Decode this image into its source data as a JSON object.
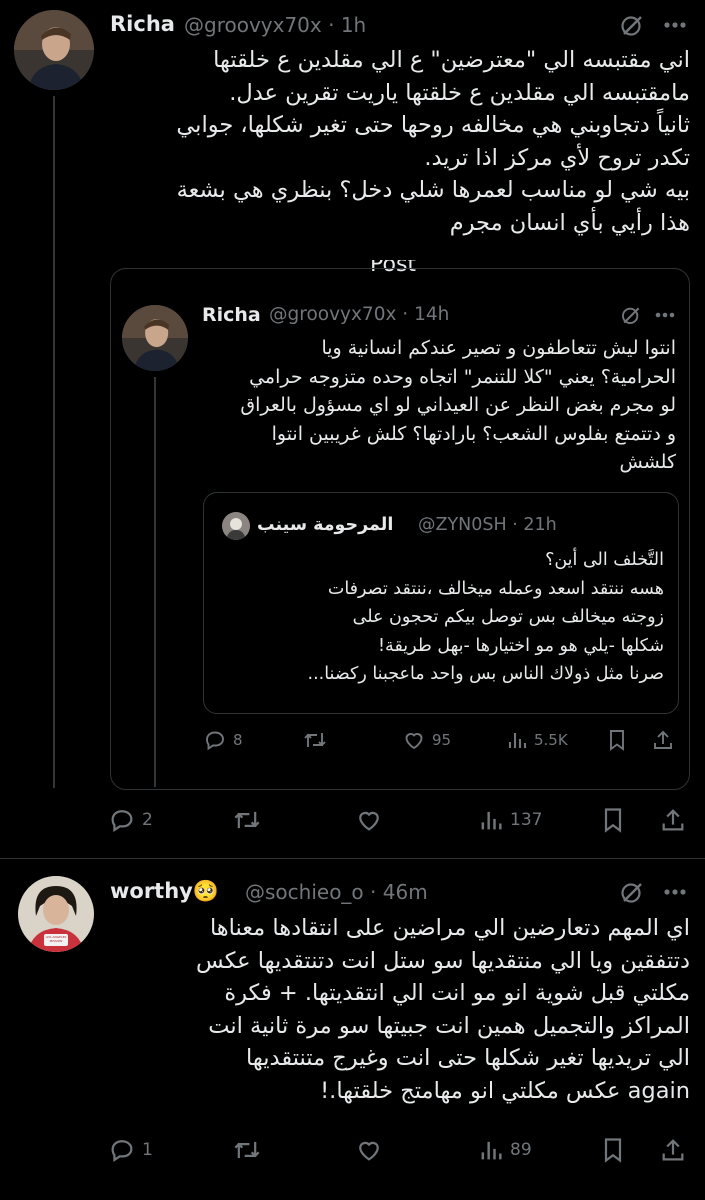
{
  "tweet1": {
    "name": "Richa",
    "handle": "@groovyx70x",
    "time": "1h",
    "text": "اني مقتبسه الي \"معترضين\" ع الي مقلدين ع خلقتها\nمامقتبسه الي مقلدين ع خلقتها ياريت تقرين عدل.\nثانياً دتجاوبني هي مخالفه روحها حتى تغير شكلها، جوابي\nتكدر تروح لأي مركز اذا تريد.\nبيه شي لو مناسب لعمرها شلي دخل؟ بنظري هي بشعة\nهذا رأيي بأي انسان مجرم",
    "fragment": "Post",
    "actions": {
      "replies": "2",
      "retweets": "",
      "likes": "",
      "views": "137"
    }
  },
  "quote1": {
    "name": "Richa",
    "handle": "@groovyx70x",
    "time": "14h",
    "text": "انتوا ليش تتعاطفون و تصير عندكم انسانية ويا\nالحرامية؟ يعني \"كلا للتنمر\" اتجاه وحده متزوجه حرامي\nلو مجرم بغض النظر عن العيداني لو اي مسؤول بالعراق\nو دتتمتع بفلوس الشعب؟ بارادتها؟ كلش غريبين انتوا\nكلشش",
    "actions": {
      "replies": "8",
      "likes": "95",
      "views": "5.5K"
    }
  },
  "quote2": {
    "name": "المرحومة سينب",
    "handle": "@ZYN0SH",
    "time": "21h",
    "text": "التَّخلف الى أين؟\nهسه ننتقد اسعد وعمله ميخالف ،ننتقد تصرفات\nزوجته ميخالف بس توصل بيكم تحجون على\nشكلها -يلي هو مو اختيارها -بهل طريقة!\nصرنا مثل ذولاك الناس بس واحد ماعجبنا ركضنا..."
  },
  "tweet2": {
    "name": "worthy",
    "emoji": "🥺",
    "handle": "@sochieo_o",
    "time": "46m",
    "text": "اي المهم دتعارضين الي مراضين على انتقادها معناها\nدتتفقين ويا الي منتقديها سو ستل انت دتنتقديها عكس\nمكلتي قبل شوية انو مو انت الي انتقديتها. + فكرة\nالمراكز والتجميل همين انت جبيتها سو مرة ثانية انت\nالي تريديها تغير شكلها حتى انت وغيرج متنتقديها\nagain عكس مكلتي انو مهامتج خلقتها.!",
    "avatar_badge": "LOS ANGELES MISSION",
    "actions": {
      "replies": "1",
      "views": "89"
    }
  },
  "colors": {
    "bg": "#000000",
    "text": "#e7e9ea",
    "muted": "#71767b",
    "border": "#2f3336"
  }
}
